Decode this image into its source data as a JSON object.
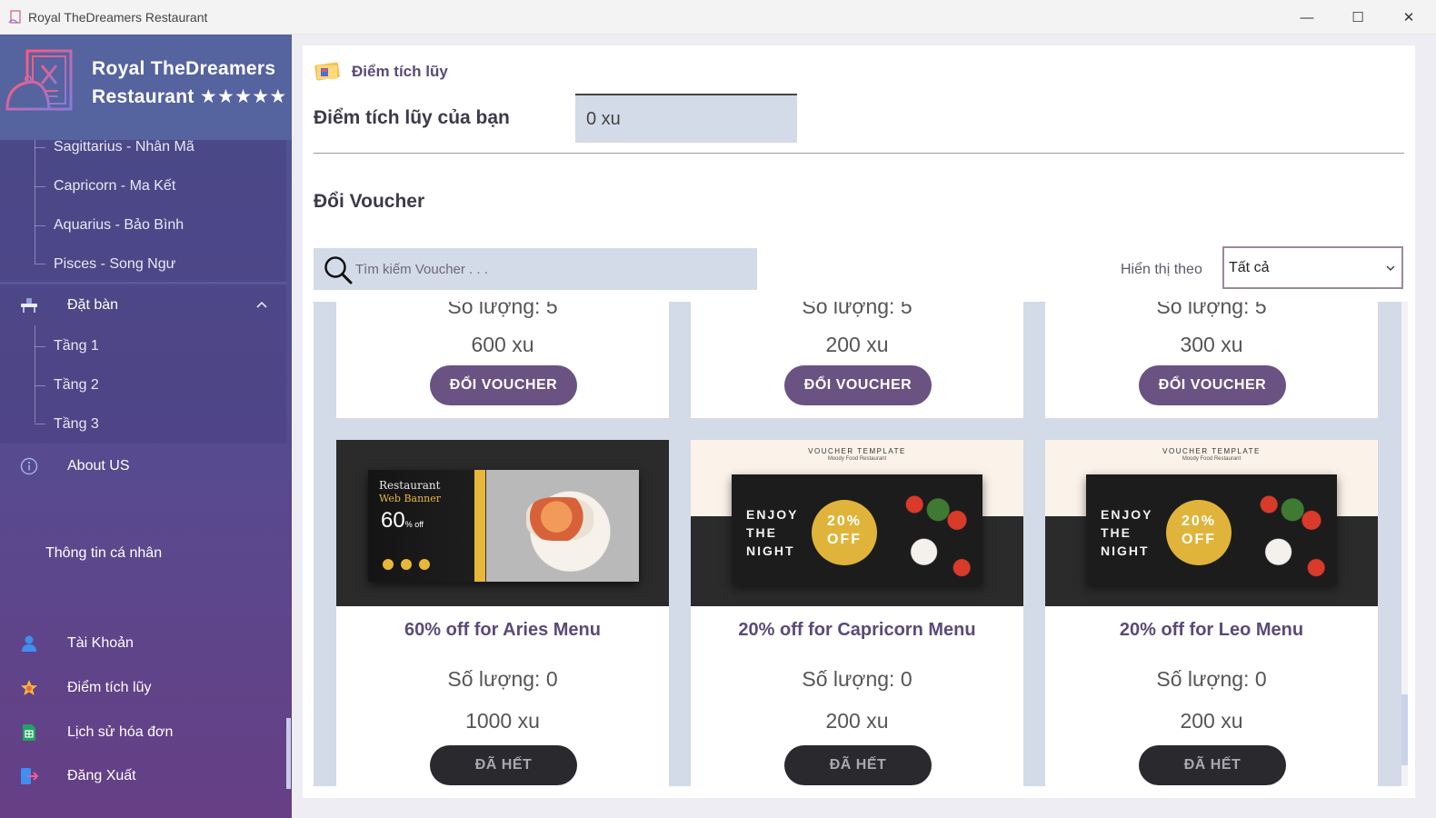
{
  "window": {
    "title": "Royal TheDreamers Restaurant",
    "controls": {
      "minimize": "—",
      "maximize": "☐",
      "close": "✕"
    }
  },
  "brand": {
    "name_line1": "Royal TheDreamers",
    "name_line2": "Restaurant ★★★★★"
  },
  "sidebar": {
    "zodiac_items": [
      {
        "label": "Sagittarius - Nhân Mã"
      },
      {
        "label": "Capricorn - Ma Kết"
      },
      {
        "label": "Aquarius - Bảo Bình"
      },
      {
        "label": "Pisces - Song Ngư"
      }
    ],
    "booking": {
      "label": "Đặt bàn",
      "icon": "table-booking-icon",
      "expanded": true
    },
    "floors": [
      {
        "label": "Tầng 1"
      },
      {
        "label": "Tầng 2"
      },
      {
        "label": "Tầng 3"
      }
    ],
    "about": {
      "label": "About US",
      "icon": "info-icon"
    },
    "profile_section": "Thông tin cá nhân",
    "account": {
      "label": "Tài Khoản",
      "icon": "user-icon"
    },
    "points": {
      "label": "Điểm tích lũy",
      "icon": "star-icon"
    },
    "history": {
      "label": "Lịch sử hóa đơn",
      "icon": "sheet-icon"
    },
    "logout": {
      "label": "Đăng Xuất",
      "icon": "logout-icon"
    }
  },
  "main": {
    "section_title": "Điểm tích lũy",
    "points_label": "Điểm tích lũy của bạn",
    "points_value": "0 xu",
    "voucher_heading": "Đổi Voucher",
    "search_placeholder": "Tìm kiếm Voucher . . .",
    "filter_label": "Hiển thị theo",
    "filter_value": "Tất cả"
  },
  "vouchers_top": [
    {
      "quantity": "Số lượng: 5",
      "price": "600 xu",
      "button": "ĐỔI VOUCHER"
    },
    {
      "quantity": "Số lượng: 5",
      "price": "200 xu",
      "button": "ĐỔI VOUCHER"
    },
    {
      "quantity": "Số lượng: 5",
      "price": "300 xu",
      "button": "ĐỔI VOUCHER"
    }
  ],
  "vouchers_bottom": [
    {
      "name": "60% off for Aries Menu",
      "quantity": "Số lượng: 0",
      "price": "1000 xu",
      "button": "ĐÃ HẾT",
      "image": {
        "line1": "Restaurant",
        "line2": "Web Banner",
        "discount": "60",
        "discount_suffix": "% off"
      }
    },
    {
      "name": "20% off for Capricorn Menu",
      "quantity": "Số lượng: 0",
      "price": "200 xu",
      "button": "ĐÃ HẾT",
      "image": {
        "header": "VOUCHER TEMPLATE",
        "subheader": "Moody Food Restaurant",
        "tagline": [
          "ENJOY",
          "THE",
          "NIGHT"
        ],
        "badge": [
          "20%",
          "OFF"
        ]
      }
    },
    {
      "name": "20% off for Leo Menu",
      "quantity": "Số lượng: 0",
      "price": "200 xu",
      "button": "ĐÃ HẾT",
      "image": {
        "header": "VOUCHER TEMPLATE",
        "subheader": "Moody Food Restaurant",
        "tagline": [
          "ENJOY",
          "THE",
          "NIGHT"
        ],
        "badge": [
          "20%",
          "OFF"
        ]
      }
    }
  ],
  "colors": {
    "sidebar_top": "#4b5795",
    "sidebar_bottom": "#663f85",
    "accent_purple": "#6a5282",
    "soldout_dark": "#2a2a2e",
    "field_bg": "#d3dae8"
  }
}
